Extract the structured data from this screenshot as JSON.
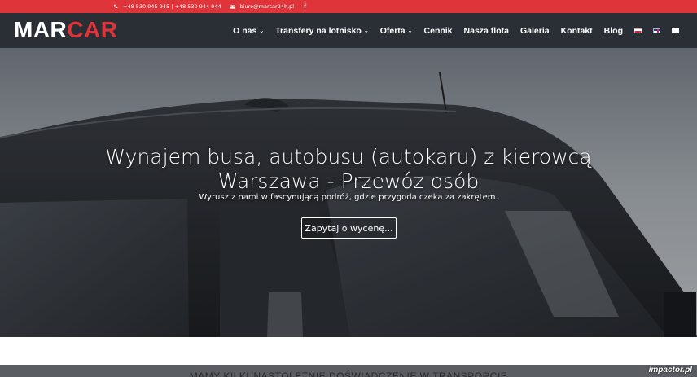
{
  "topbar": {
    "phones": "+48 530 945 945 | +48 530 944 944",
    "email": "biuro@marcar24h.pl",
    "facebook_icon": "facebook-icon"
  },
  "logo": {
    "part1": "MAR",
    "part2": "CAR"
  },
  "nav": {
    "items": [
      {
        "label": "O nas",
        "dropdown": true
      },
      {
        "label": "Transfery na lotnisko",
        "dropdown": true
      },
      {
        "label": "Oferta",
        "dropdown": true
      },
      {
        "label": "Cennik",
        "dropdown": false
      },
      {
        "label": "Nasza flota",
        "dropdown": false
      },
      {
        "label": "Galeria",
        "dropdown": false
      },
      {
        "label": "Kontakt",
        "dropdown": false
      },
      {
        "label": "Blog",
        "dropdown": false
      }
    ],
    "languages": [
      "pl-flag-icon",
      "en-flag-icon",
      "il-flag-icon"
    ]
  },
  "hero": {
    "title_line1": "Wynajem busa, autobusu (autokaru) z kierowcą",
    "title_line2": "Warszawa - Przewóz osób",
    "subtitle": "Wyrusz z nami w fascynującą podróż, gdzie przygoda czeka za zakrętem.",
    "cta_label": "Zapytaj o wycenę..."
  },
  "section": {
    "heading": "Mamy kilkunastoletnie doświadczenie w transporcie"
  },
  "watermark": "impactor.pl",
  "colors": {
    "accent": "#e0343b",
    "nav_bg": "#2a2f36"
  }
}
